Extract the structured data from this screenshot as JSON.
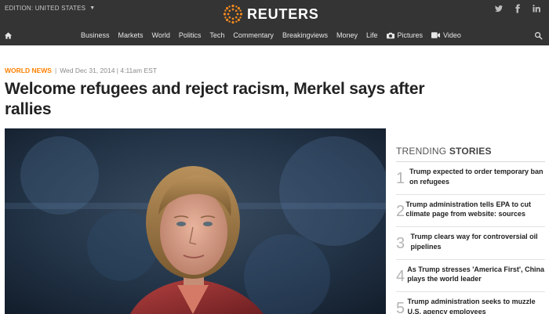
{
  "header": {
    "edition_label": "EDITION: UNITED STATES",
    "brand": "REUTERS",
    "social": [
      "twitter-icon",
      "facebook-icon",
      "linkedin-icon"
    ]
  },
  "nav": {
    "items": [
      {
        "label": "Business"
      },
      {
        "label": "Markets"
      },
      {
        "label": "World"
      },
      {
        "label": "Politics"
      },
      {
        "label": "Tech"
      },
      {
        "label": "Commentary"
      },
      {
        "label": "Breakingviews"
      },
      {
        "label": "Money"
      },
      {
        "label": "Life"
      },
      {
        "label": "Pictures",
        "icon": "camera-icon"
      },
      {
        "label": "Video",
        "icon": "video-icon"
      }
    ]
  },
  "article": {
    "section": "WORLD NEWS",
    "separator": "|",
    "date": "Wed Dec 31, 2014 | 4:11am EST",
    "headline": "Welcome refugees and reject racism, Merkel says after rallies"
  },
  "trending": {
    "title_prefix": "TRENDING",
    "title_suffix": "STORIES",
    "stories": [
      {
        "num": "1",
        "text": "Trump expected to order temporary ban on refugees"
      },
      {
        "num": "2",
        "text": "Trump administration tells EPA to cut climate page from website: sources"
      },
      {
        "num": "3",
        "text": "Trump clears way for controversial oil pipelines"
      },
      {
        "num": "4",
        "text": "As Trump stresses 'America First', China plays the world leader"
      },
      {
        "num": "5",
        "text": "Trump administration seeks to muzzle U.S. agency employees"
      }
    ]
  },
  "colors": {
    "topbar": "#343434",
    "accent": "#ff8000",
    "logo_orange": "#f58a1f"
  }
}
